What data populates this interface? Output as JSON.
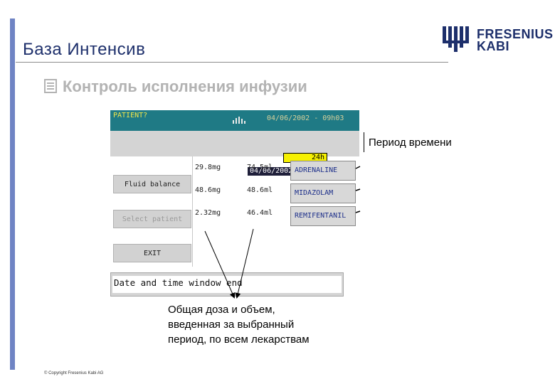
{
  "slide": {
    "title": "База Интенсив",
    "subtitle": "Контроль исполнения инфузии",
    "copyright": "© Copyright Fresenius Kabi AG"
  },
  "logo": {
    "line1": "FRESENIUS",
    "line2": "KABI",
    "color": "#1d2f6b"
  },
  "device": {
    "patient_label": "PATIENT?",
    "datetime": "04/06/2002 - 09h03",
    "period": "24h",
    "period_end": "04/06/2002 09h00",
    "buttons": {
      "fluid_balance": "Fluid balance",
      "select_patient": "Select patient",
      "exit": "EXIT"
    },
    "rows": [
      {
        "dose": "29.8mg",
        "volume": "74.5ml",
        "drug": "ADRENALINE"
      },
      {
        "dose": "48.6mg",
        "volume": "48.6ml",
        "drug": "MIDAZOLAM"
      },
      {
        "dose": "2.32mg",
        "volume": "46.4ml",
        "drug": "REMIFENTANIL"
      }
    ],
    "status_text": "Date and time window end",
    "colors": {
      "title_bar": "#1f7a85",
      "patient_text": "#f2e64b",
      "period_highlight": "#f5f000"
    }
  },
  "annotations": {
    "period_callout": "Период времени",
    "dose_caption_1": "Общая доза и объем,",
    "dose_caption_2": "введенная за выбранный",
    "dose_caption_3": "период, по всем лекарствам"
  }
}
